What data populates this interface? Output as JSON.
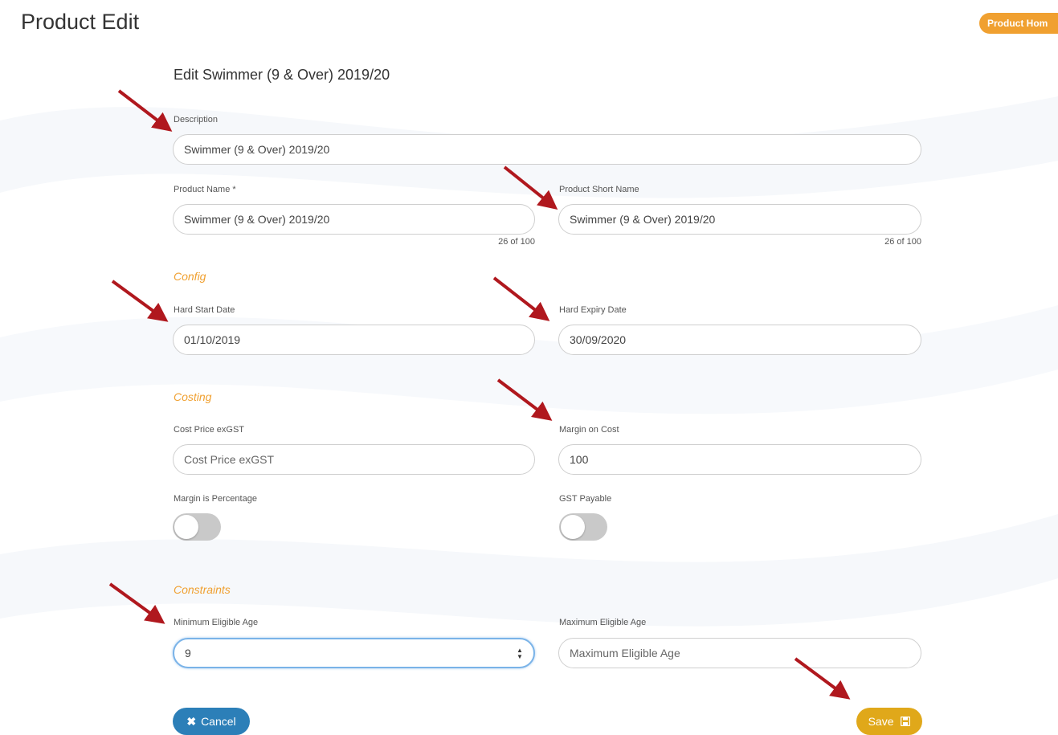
{
  "page": {
    "title": "Product Edit",
    "home_button": "Product Hom"
  },
  "form": {
    "heading": "Edit Swimmer (9 & Over) 2019/20",
    "description": {
      "label": "Description",
      "value": "Swimmer (9 & Over) 2019/20"
    },
    "product_name": {
      "label": "Product Name *",
      "value": "Swimmer (9 & Over) 2019/20",
      "counter": "26 of 100"
    },
    "product_short_name": {
      "label": "Product Short Name",
      "value": "Swimmer (9 & Over) 2019/20",
      "counter": "26 of 100"
    },
    "config": {
      "title": "Config",
      "hard_start_date": {
        "label": "Hard Start Date",
        "value": "01/10/2019"
      },
      "hard_expiry_date": {
        "label": "Hard Expiry Date",
        "value": "30/09/2020"
      }
    },
    "costing": {
      "title": "Costing",
      "cost_price": {
        "label": "Cost Price exGST",
        "placeholder": "Cost Price exGST"
      },
      "margin_on_cost": {
        "label": "Margin on Cost",
        "value": "100"
      },
      "margin_is_percentage": {
        "label": "Margin is Percentage",
        "on": false
      },
      "gst_payable": {
        "label": "GST Payable",
        "on": false
      }
    },
    "constraints": {
      "title": "Constraints",
      "min_age": {
        "label": "Minimum Eligible Age",
        "value": "9"
      },
      "max_age": {
        "label": "Maximum Eligible Age",
        "placeholder": "Maximum Eligible Age"
      }
    },
    "buttons": {
      "cancel": "Cancel",
      "save": "Save"
    }
  },
  "colors": {
    "accent": "#f0a030",
    "cancel": "#2c7fb8",
    "save": "#e0a81a",
    "arrow": "#b0181e"
  }
}
